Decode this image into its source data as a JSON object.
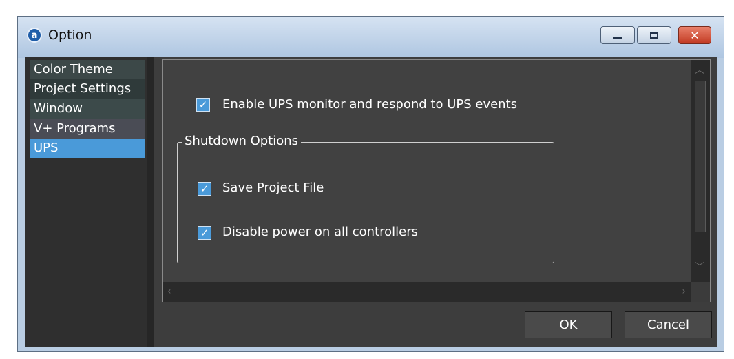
{
  "window": {
    "title": "Option",
    "icon": "app-logo-icon",
    "controls": {
      "minimize": "minimize-icon",
      "maximize": "maximize-icon",
      "close": "✕"
    }
  },
  "sidebar": {
    "items": [
      {
        "label": "Color Theme"
      },
      {
        "label": "Project Settings"
      },
      {
        "label": "Window"
      },
      {
        "label": "V+ Programs"
      },
      {
        "label": "UPS",
        "selected": true
      }
    ]
  },
  "ups": {
    "enable_label": "Enable UPS monitor and respond to UPS events",
    "enable_checked": true,
    "shutdown_group": {
      "title": "Shutdown Options",
      "options": [
        {
          "label": "Save Project File",
          "checked": true
        },
        {
          "label": "Disable power on all controllers",
          "checked": true
        }
      ]
    }
  },
  "buttons": {
    "ok": "OK",
    "cancel": "Cancel"
  },
  "colors": {
    "accent": "#4a9ad9",
    "panel": "#414141",
    "background": "#3d3d3d"
  }
}
